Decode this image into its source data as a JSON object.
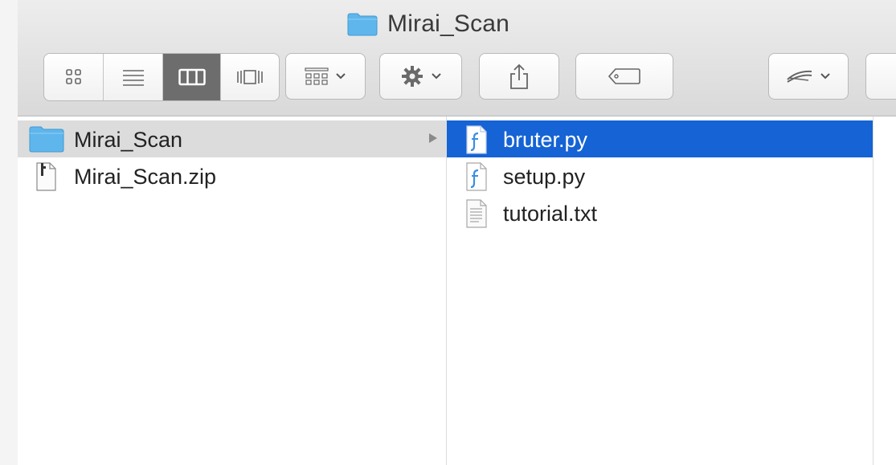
{
  "window": {
    "title": "Mirai_Scan"
  },
  "toolbar": {
    "view_buttons": [
      "icon-view",
      "list-view",
      "column-view",
      "cover-flow-view"
    ],
    "active_view": "column-view",
    "arrange_icon": "arrange-grid-icon",
    "action_icon": "gear-icon",
    "share_icon": "share-icon",
    "tag_icon": "tag-icon",
    "sync_icon": "dropbox-sync-icon"
  },
  "columns": [
    {
      "items": [
        {
          "name": "Mirai_Scan",
          "icon": "folder-icon",
          "selected": "inactive",
          "has_children": true
        },
        {
          "name": "Mirai_Scan.zip",
          "icon": "zip-file-icon",
          "selected": "none",
          "has_children": false
        }
      ]
    },
    {
      "items": [
        {
          "name": "bruter.py",
          "icon": "python-file-icon",
          "selected": "active",
          "has_children": false
        },
        {
          "name": "setup.py",
          "icon": "python-file-icon",
          "selected": "none",
          "has_children": false
        },
        {
          "name": "tutorial.txt",
          "icon": "text-file-icon",
          "selected": "none",
          "has_children": false
        }
      ]
    }
  ],
  "colors": {
    "selection_active": "#1563d4",
    "selection_inactive": "#dcdcdc",
    "folder": "#5fb6ec",
    "toolbar_top": "#ededed",
    "toolbar_bottom": "#d9d9d9"
  }
}
